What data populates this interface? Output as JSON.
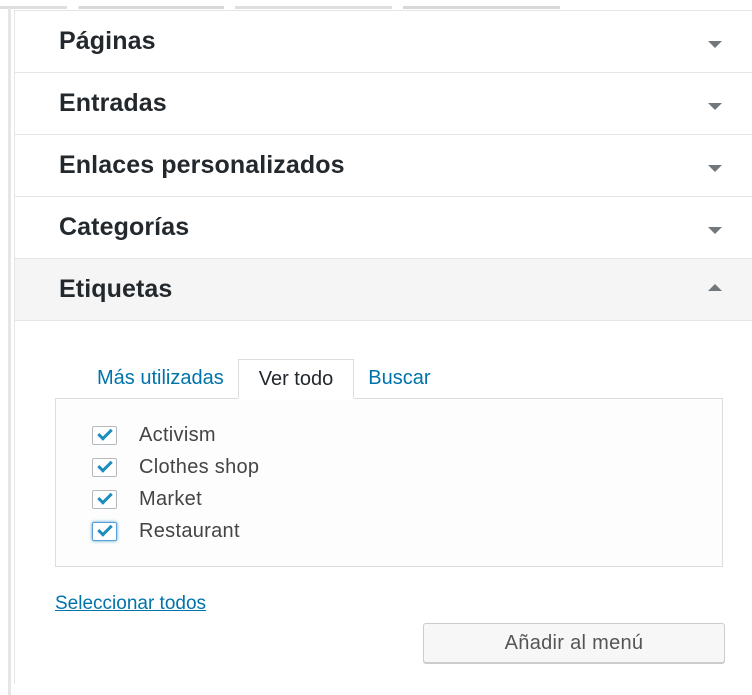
{
  "sections": [
    {
      "title": "Páginas",
      "expanded": false,
      "arrow": "arrow-down-icon"
    },
    {
      "title": "Entradas",
      "expanded": false,
      "arrow": "arrow-down-icon"
    },
    {
      "title": "Enlaces personalizados",
      "expanded": false,
      "arrow": "arrow-down-icon"
    },
    {
      "title": "Categorías",
      "expanded": false,
      "arrow": "arrow-down-icon"
    },
    {
      "title": "Etiquetas",
      "expanded": true,
      "arrow": "arrow-up-icon"
    }
  ],
  "tags_panel": {
    "tabs": [
      {
        "label": "Más utilizadas",
        "active": false
      },
      {
        "label": "Ver todo",
        "active": true
      },
      {
        "label": "Buscar",
        "active": false
      }
    ],
    "items": [
      {
        "label": "Activism",
        "checked": true
      },
      {
        "label": "Clothes shop",
        "checked": true
      },
      {
        "label": "Market",
        "checked": true
      },
      {
        "label": "Restaurant",
        "checked": true
      }
    ],
    "select_all_label": "Seleccionar todos",
    "add_button_label": "Añadir al menú"
  },
  "colors": {
    "link": "#0073aa",
    "heading": "#23282d",
    "checkmark": "#1e8cbe",
    "border": "#dddddd"
  }
}
